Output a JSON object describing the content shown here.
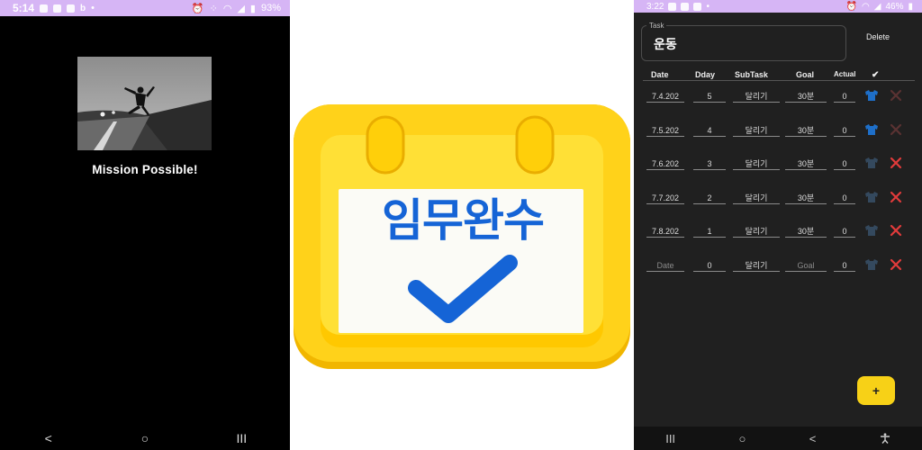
{
  "left_phone": {
    "status_bar": {
      "time": "5:14",
      "battery": "93%"
    },
    "title": "Mission Possible!",
    "nav": {
      "back": "<",
      "home": "○",
      "recents": "III"
    }
  },
  "logo": {
    "text": "임무완수",
    "accent": "#1564d6",
    "brand": "#f7d117"
  },
  "right_phone": {
    "status_bar": {
      "time": "3:22",
      "battery": "46%"
    },
    "task": {
      "label": "Task",
      "value": "운동"
    },
    "delete_label": "Delete",
    "headers": {
      "date": "Date",
      "dday": "Dday",
      "subtask": "SubTask",
      "goal": "Goal",
      "actual": "Actual",
      "done": "✔"
    },
    "rows": [
      {
        "date": "7.4.202",
        "dday": "5",
        "subtask": "달리기",
        "goal": "30분",
        "actual": "0",
        "delete_state": "disabled"
      },
      {
        "date": "7.5.202",
        "dday": "4",
        "subtask": "달리기",
        "goal": "30분",
        "actual": "0",
        "delete_state": "disabled"
      },
      {
        "date": "7.6.202",
        "dday": "3",
        "subtask": "달리기",
        "goal": "30분",
        "actual": "0",
        "delete_state": "active"
      },
      {
        "date": "7.7.202",
        "dday": "2",
        "subtask": "달리기",
        "goal": "30분",
        "actual": "0",
        "delete_state": "active"
      },
      {
        "date": "7.8.202",
        "dday": "1",
        "subtask": "달리기",
        "goal": "30분",
        "actual": "0",
        "delete_state": "active"
      },
      {
        "date": "Date",
        "dday": "0",
        "subtask": "달리기",
        "goal": "Goal",
        "actual": "0",
        "delete_state": "active"
      }
    ],
    "fab_label": "+",
    "nav": {
      "recents": "III",
      "home": "○",
      "back": "<",
      "accessibility": "accessibility-icon"
    },
    "colors": {
      "shirt_active": "#1e6fc9",
      "shirt_muted": "#34495e",
      "x_active": "#e23b3b",
      "x_disabled": "#5a3232"
    }
  }
}
